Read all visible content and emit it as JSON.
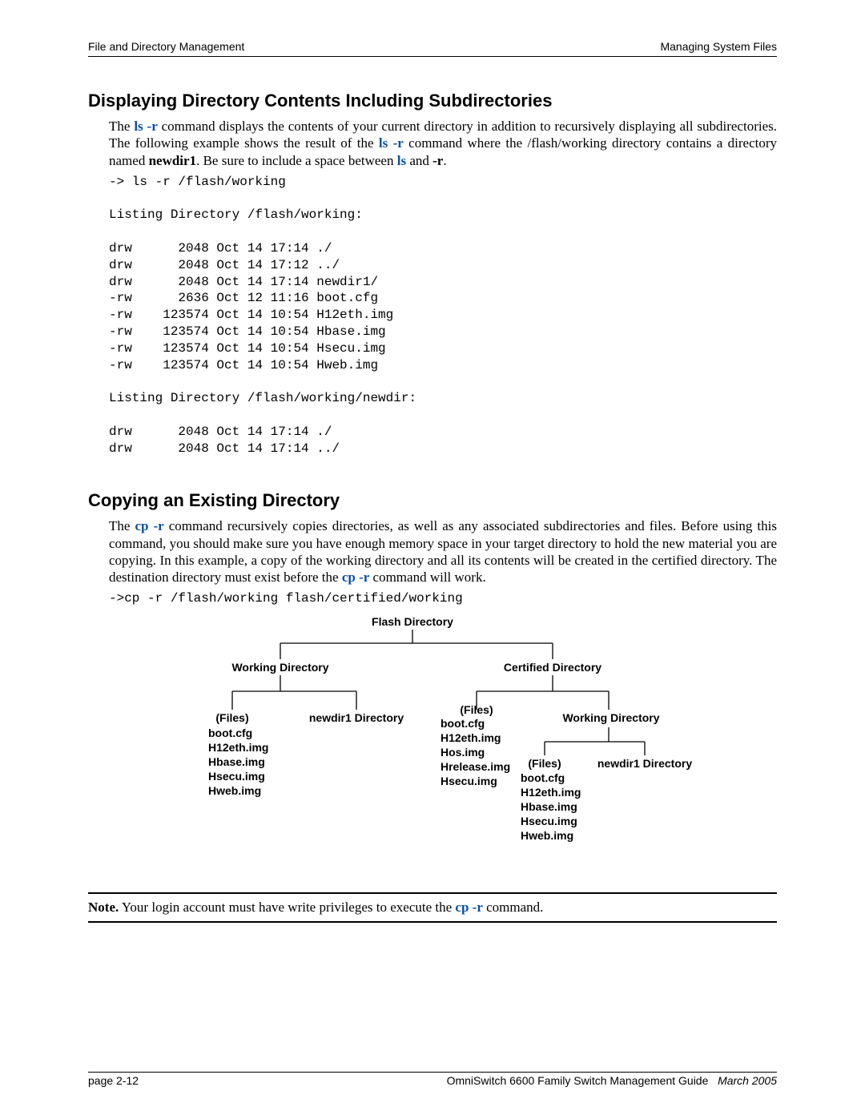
{
  "header": {
    "left": "File and Directory Management",
    "right": "Managing System Files"
  },
  "section1": {
    "title": "Displaying Directory Contents Including Subdirectories",
    "para_before": "The ",
    "cmd1": "ls -r",
    "para_mid1": " command displays the contents of your current directory in addition to recursively displaying all subdirectories. The following example shows the result of the ",
    "cmd2": "ls -r",
    "para_mid2": " command where the /flash/working directory contains a directory named ",
    "bold1": "newdir1",
    "para_mid3": ". Be sure to include a space between ",
    "cmd3": "ls",
    "para_mid4": " and ",
    "cmd4": "-r",
    "para_end": ".",
    "code": "-> ls -r /flash/working\n\nListing Directory /flash/working:\n\ndrw      2048 Oct 14 17:14 ./\ndrw      2048 Oct 14 17:12 ../\ndrw      2048 Oct 14 17:14 newdir1/\n-rw      2636 Oct 12 11:16 boot.cfg\n-rw    123574 Oct 14 10:54 H12eth.img\n-rw    123574 Oct 14 10:54 Hbase.img\n-rw    123574 Oct 14 10:54 Hsecu.img\n-rw    123574 Oct 14 10:54 Hweb.img\n\nListing Directory /flash/working/newdir:\n\ndrw      2048 Oct 14 17:14 ./\ndrw      2048 Oct 14 17:14 ../"
  },
  "section2": {
    "title": "Copying an Existing Directory",
    "para_before": "The ",
    "cmd1": "cp -r",
    "para_mid1": " command recursively copies directories, as well as any associated subdirectories and files. Before using this command, you should make sure you have enough memory space in your target directory to hold the new material you are copying. In this example, a copy of the working directory and all its contents will be created in the certified directory. The destination directory must exist before the ",
    "cmd2": "cp -r",
    "para_end": " command will work.",
    "code": "->cp -r /flash/working flash/certified/working"
  },
  "diagram": {
    "flash": "Flash Directory",
    "working": "Working Directory",
    "certified": "Certified Directory",
    "files": "(Files)",
    "newdir1": "newdir1 Directory",
    "working2": "Working Directory",
    "left_files": "boot.cfg\nH12eth.img\nHbase.img\nHsecu.img\nHweb.img",
    "mid_files": "boot.cfg\nH12eth.img\nHos.img\nHrelease.img\nHsecu.img",
    "right_files": "boot.cfg\nH12eth.img\nHbase.img\nHsecu.img\nHweb.img"
  },
  "note": {
    "label": "Note.",
    "before": " Your login account must have write privileges to execute the ",
    "cmd": "cp -r",
    "after": " command."
  },
  "footer": {
    "page": "page 2-12",
    "guide": "OmniSwitch 6600 Family Switch Management Guide",
    "date": "March 2005"
  }
}
